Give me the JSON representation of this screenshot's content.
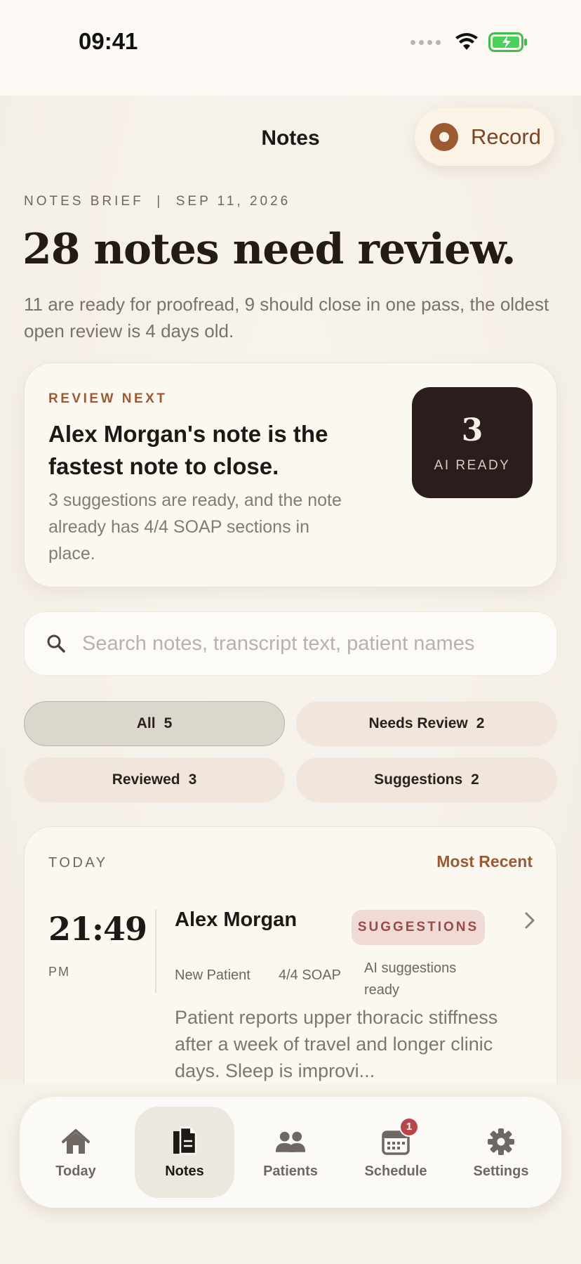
{
  "status_bar": {
    "time": "09:41"
  },
  "header": {
    "title": "Notes",
    "record_label": "Record"
  },
  "brief": {
    "kicker": "NOTES BRIEF  |  SEP 11, 2026",
    "headline": "28 notes need review.",
    "subline": "11 are ready for proofread, 9 should close in one pass, the oldest open review is 4 days old."
  },
  "review_next": {
    "kicker": "REVIEW NEXT",
    "title": "Alex Morgan's note is the fastest note to close.",
    "body": "3 suggestions are ready, and the note already has 4/4 SOAP sections in place.",
    "ai_count": "3",
    "ai_label": "AI READY"
  },
  "search": {
    "placeholder": "Search notes, transcript text, patient names",
    "value": ""
  },
  "filters": [
    {
      "label": "All",
      "count": "5",
      "active": true
    },
    {
      "label": "Needs Review",
      "count": "2",
      "active": false
    },
    {
      "label": "Reviewed",
      "count": "3",
      "active": false
    },
    {
      "label": "Suggestions",
      "count": "2",
      "active": false
    }
  ],
  "notes_section": {
    "group_label": "TODAY",
    "sort_label": "Most Recent",
    "items": [
      {
        "time": "21:49",
        "ampm": "PM",
        "patient": "Alex Morgan",
        "badge": "SUGGESTIONS",
        "visit_type": "New Patient",
        "soap": "4/4 SOAP",
        "ai_status": "AI suggestions ready",
        "excerpt": "Patient reports upper thoracic stiffness after a week of travel and longer clinic days. Sleep is improvi..."
      }
    ]
  },
  "tabbar": {
    "items": [
      {
        "label": "Today",
        "icon": "home-icon"
      },
      {
        "label": "Notes",
        "icon": "notes-icon",
        "active": true
      },
      {
        "label": "Patients",
        "icon": "patients-icon"
      },
      {
        "label": "Schedule",
        "icon": "calendar-icon",
        "badge": "1"
      },
      {
        "label": "Settings",
        "icon": "gear-icon"
      }
    ]
  },
  "colors": {
    "accent": "#9b5a32",
    "dark_tile": "#2b1d1c",
    "badge_bg": "#efdad5",
    "badge_text": "#9a4a49",
    "notification": "#b84548"
  }
}
